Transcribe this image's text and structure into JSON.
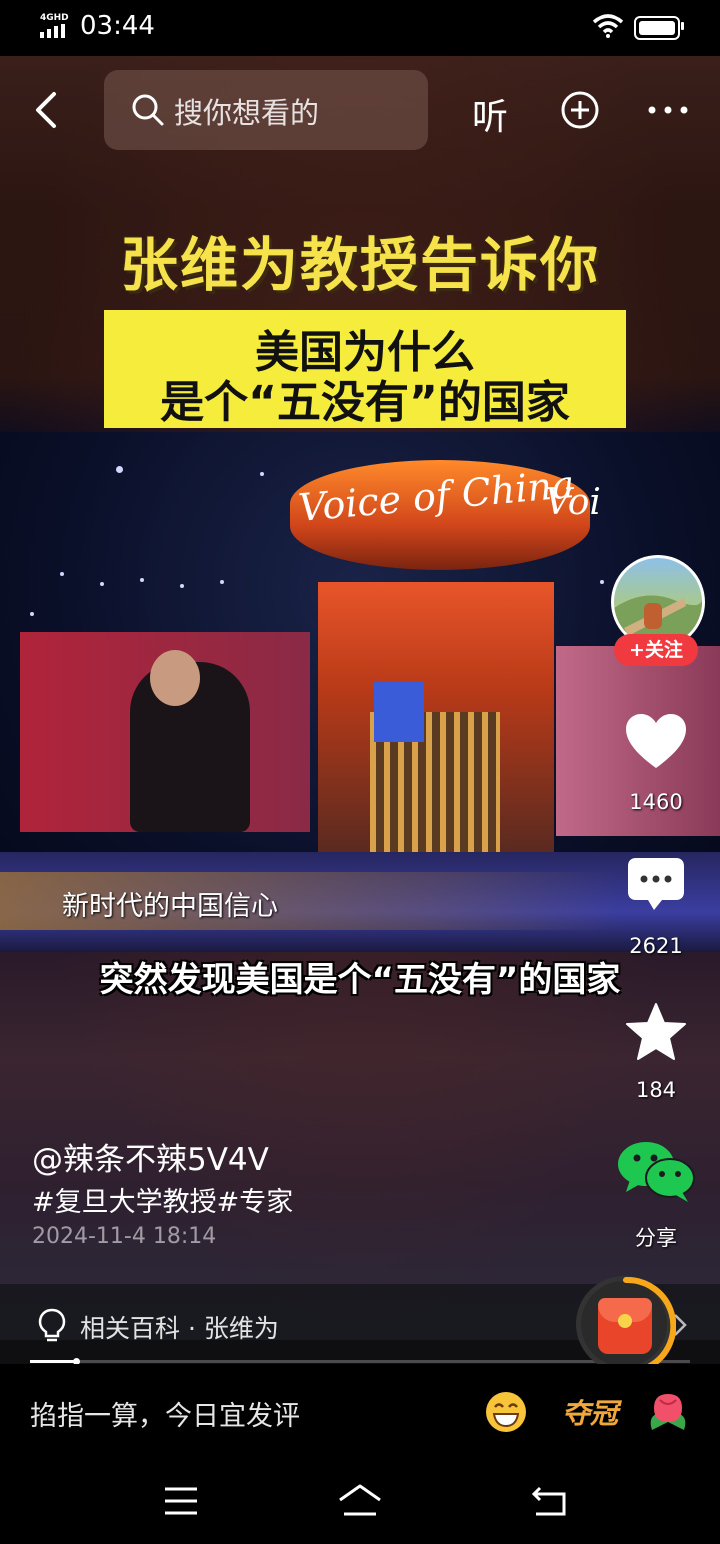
{
  "status": {
    "network": "4GHD",
    "time": "03:44"
  },
  "topbar": {
    "search_placeholder": "搜你想看的",
    "listen_label": "听"
  },
  "video": {
    "title_line": "张维为教授告诉你",
    "banner_line1": "美国为什么",
    "banner_line2": "是个“五没有”的国家",
    "stage_sign": "Voice of China",
    "stage_sign_partial": "Voi",
    "lower_third": "新时代的中国信心",
    "subtitle": "突然发现美国是个“五没有”的国家"
  },
  "actions": {
    "follow_label": "+关注",
    "likes": "1460",
    "comments": "2621",
    "favorites": "184",
    "share_label": "分享"
  },
  "post": {
    "author": "@辣条不辣5V4V",
    "tags": "#复旦大学教授#专家",
    "date": "2024-11-4 18:14"
  },
  "related": {
    "label": "相关百科 · 张维为"
  },
  "playback": {
    "progress": 0.07
  },
  "comment_bar": {
    "prompt": "掐指一算，今日宜发评",
    "sticker_text": "夺冠"
  },
  "colors": {
    "title_yellow": "#f6e24a",
    "banner_yellow": "#f5ec3c",
    "follow_red": "#f03a40",
    "wechat_green": "#1ec850",
    "ring_orange": "#f7a81a"
  }
}
